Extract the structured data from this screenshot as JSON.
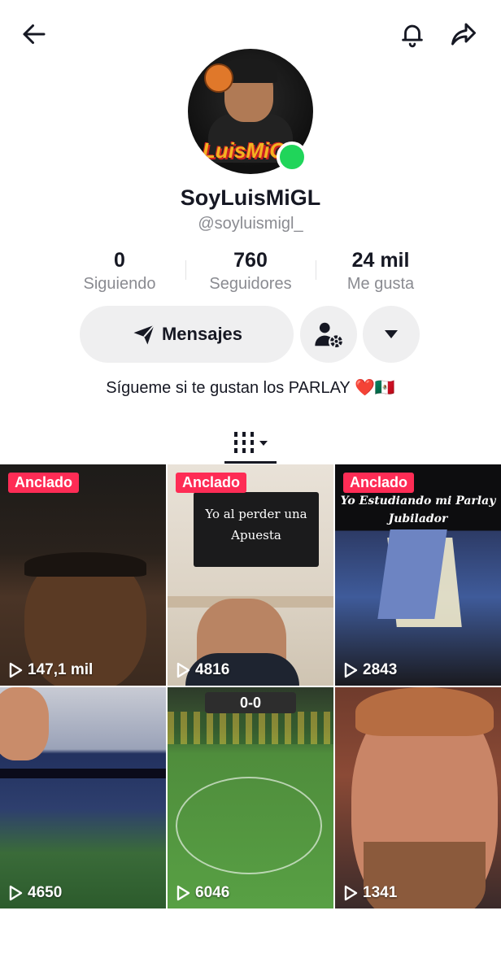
{
  "profile": {
    "display_name": "SoyLuisMiGL",
    "username": "@soyluismigl_",
    "avatar_text": "LuisMiGL",
    "bio": "Sígueme si te gustan los PARLAY ❤️🇲🇽"
  },
  "stats": [
    {
      "value": "0",
      "label": "Siguiendo"
    },
    {
      "value": "760",
      "label": "Seguidores"
    },
    {
      "value": "24 mil",
      "label": "Me gusta"
    }
  ],
  "actions": {
    "message_label": "Mensajes"
  },
  "videos": [
    {
      "badge": "Anclado",
      "views": "147,1 mil",
      "caption": ""
    },
    {
      "badge": "Anclado",
      "views": "4816",
      "caption": "Yo al perder una Apuesta"
    },
    {
      "badge": "Anclado",
      "views": "2843",
      "caption": "Yo Estudiando mi Parlay Jubilador"
    },
    {
      "badge": "",
      "views": "4650",
      "caption": ""
    },
    {
      "badge": "",
      "views": "6046",
      "caption": "0-0"
    },
    {
      "badge": "",
      "views": "1341",
      "caption": ""
    }
  ],
  "colors": {
    "accent": "#fe2c55",
    "online": "#20d55a",
    "muted_text": "#8a8b91",
    "button_bg": "#efeff0"
  }
}
